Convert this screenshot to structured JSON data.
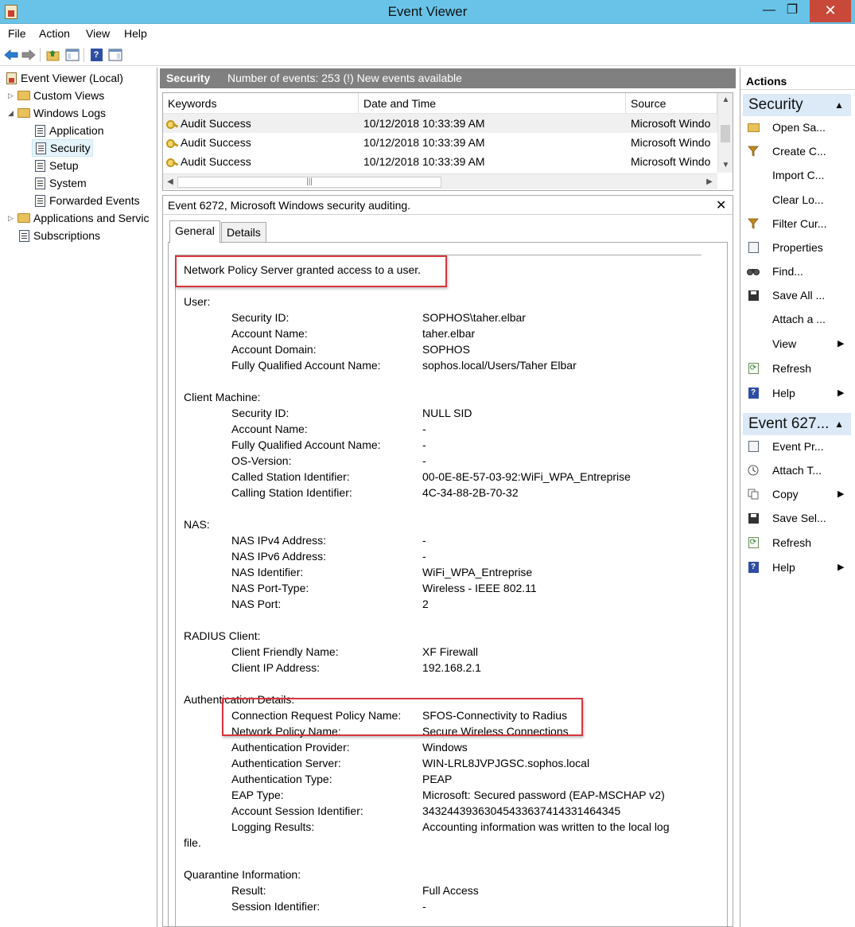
{
  "window": {
    "title": "Event Viewer",
    "controls": {
      "minimize": "—",
      "maximize": "❐",
      "close": "✕"
    }
  },
  "menu": [
    "File",
    "Action",
    "View",
    "Help"
  ],
  "toolbar": {
    "icons": [
      "back-arrow-icon",
      "forward-arrow-icon",
      "folder-up-icon",
      "console-tree-icon",
      "help-icon",
      "show-hide-pane-icon"
    ]
  },
  "tree": {
    "root": "Event Viewer (Local)",
    "items": [
      {
        "label": "Custom Views"
      },
      {
        "label": "Windows Logs"
      },
      {
        "label": "Application"
      },
      {
        "label": "Security"
      },
      {
        "label": "Setup"
      },
      {
        "label": "System"
      },
      {
        "label": "Forwarded Events"
      },
      {
        "label": "Applications and Servic"
      },
      {
        "label": "Subscriptions"
      }
    ]
  },
  "log_header": {
    "name": "Security",
    "info": "Number of events: 253 (!) New events available"
  },
  "event_list": {
    "columns": [
      "Keywords",
      "Date and Time",
      "Source"
    ],
    "rows": [
      {
        "keywords": "Audit Success",
        "datetime": "10/12/2018 10:33:39 AM",
        "source": "Microsoft Windo"
      },
      {
        "keywords": "Audit Success",
        "datetime": "10/12/2018 10:33:39 AM",
        "source": "Microsoft Windo"
      },
      {
        "keywords": "Audit Success",
        "datetime": "10/12/2018 10:33:39 AM",
        "source": "Microsoft Windo"
      }
    ],
    "hscroll_grip": "|||"
  },
  "detail": {
    "title": "Event 6272, Microsoft Windows security auditing.",
    "close": "✕",
    "tabs": [
      "General",
      "Details"
    ],
    "summary": "Network Policy Server granted access to a user.",
    "sections": [
      {
        "heading": "User:",
        "fields": [
          {
            "label": "Security ID:",
            "value": "SOPHOS\\taher.elbar"
          },
          {
            "label": "Account Name:",
            "value": "taher.elbar"
          },
          {
            "label": "Account Domain:",
            "value": "SOPHOS"
          },
          {
            "label": "Fully Qualified Account Name:",
            "value": "sophos.local/Users/Taher Elbar"
          }
        ]
      },
      {
        "heading": "Client Machine:",
        "fields": [
          {
            "label": "Security ID:",
            "value": "NULL SID"
          },
          {
            "label": "Account Name:",
            "value": "-"
          },
          {
            "label": "Fully Qualified Account Name:",
            "value": "-"
          },
          {
            "label": "OS-Version:",
            "value": "-"
          },
          {
            "label": "Called Station Identifier:",
            "value": "00-0E-8E-57-03-92:WiFi_WPA_Entreprise"
          },
          {
            "label": "Calling Station Identifier:",
            "value": "4C-34-88-2B-70-32"
          }
        ]
      },
      {
        "heading": "NAS:",
        "fields": [
          {
            "label": "NAS IPv4 Address:",
            "value": "-"
          },
          {
            "label": "NAS IPv6 Address:",
            "value": "-"
          },
          {
            "label": "NAS Identifier:",
            "value": "WiFi_WPA_Entreprise"
          },
          {
            "label": "NAS Port-Type:",
            "value": "Wireless - IEEE 802.11"
          },
          {
            "label": "NAS Port:",
            "value": "2"
          }
        ]
      },
      {
        "heading": "RADIUS Client:",
        "fields": [
          {
            "label": "Client Friendly Name:",
            "value": "XF Firewall"
          },
          {
            "label": "Client IP Address:",
            "value": "192.168.2.1"
          }
        ]
      },
      {
        "heading": "Authentication Details:",
        "fields": [
          {
            "label": "Connection Request Policy Name:",
            "value": "SFOS-Connectivity to Radius"
          },
          {
            "label": "Network Policy Name:",
            "value": "Secure Wireless Connections"
          },
          {
            "label": "Authentication Provider:",
            "value": "Windows"
          },
          {
            "label": "Authentication Server:",
            "value": "WIN-LRL8JVPJGSC.sophos.local"
          },
          {
            "label": "Authentication Type:",
            "value": "PEAP"
          },
          {
            "label": "EAP Type:",
            "value": "Microsoft: Secured password (EAP-MSCHAP v2)"
          },
          {
            "label": "Account Session Identifier:",
            "value": "34324439363045433637414331464345"
          },
          {
            "label": "Logging Results:",
            "value": "Accounting information was written to the local log"
          }
        ],
        "wrap": "file."
      },
      {
        "heading": "Quarantine Information:",
        "fields": [
          {
            "label": "Result:",
            "value": "Full Access"
          },
          {
            "label": "Session Identifier:",
            "value": "-"
          }
        ]
      }
    ]
  },
  "actions": {
    "header": "Actions",
    "sections": [
      {
        "title": "Security",
        "items": [
          {
            "label": "Open Sa...",
            "icon": "open-folder-icon"
          },
          {
            "label": "Create C...",
            "icon": "filter-icon"
          },
          {
            "label": "Import C...",
            "icon": ""
          },
          {
            "label": "Clear Lo...",
            "icon": ""
          },
          {
            "label": "Filter Cur...",
            "icon": "filter-icon"
          },
          {
            "label": "Properties",
            "icon": "properties-icon"
          },
          {
            "label": "Find...",
            "icon": "binoculars-icon"
          },
          {
            "label": "Save All ...",
            "icon": "save-icon"
          },
          {
            "label": "Attach a ...",
            "icon": ""
          },
          {
            "label": "View",
            "icon": "",
            "submenu": true
          },
          {
            "label": "Refresh",
            "icon": "refresh-icon"
          },
          {
            "label": "Help",
            "icon": "help-icon",
            "submenu": true
          }
        ]
      },
      {
        "title": "Event 627...",
        "items": [
          {
            "label": "Event Pr...",
            "icon": "event-properties-icon"
          },
          {
            "label": "Attach T...",
            "icon": "attach-task-icon"
          },
          {
            "label": "Copy",
            "icon": "copy-icon",
            "submenu": true
          },
          {
            "label": "Save Sel...",
            "icon": "save-icon"
          },
          {
            "label": "Refresh",
            "icon": "refresh-icon"
          },
          {
            "label": "Help",
            "icon": "help-icon",
            "submenu": true
          }
        ]
      }
    ],
    "collapse_glyph": "▲",
    "submenu_glyph": "▶"
  }
}
